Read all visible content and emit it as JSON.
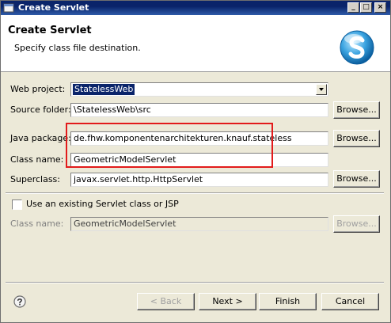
{
  "window": {
    "title": "Create Servlet",
    "controls": {
      "minimize": "_",
      "maximize": "□",
      "close": "×"
    }
  },
  "header": {
    "title": "Create Servlet",
    "subtitle": "Specify class file destination."
  },
  "form": {
    "web_project": {
      "label": "Web project:",
      "value": "StatelessWeb"
    },
    "source_folder": {
      "label": "Source folder:",
      "value": "\\StatelessWeb\\src",
      "browse": "Browse..."
    },
    "java_package": {
      "label": "Java package:",
      "value": "de.fhw.komponentenarchitekturen.knauf.stateless",
      "browse": "Browse..."
    },
    "class_name": {
      "label": "Class name:",
      "value": "GeometricModelServlet"
    },
    "superclass": {
      "label": "Superclass:",
      "value": "javax.servlet.http.HttpServlet",
      "browse": "Browse..."
    },
    "use_existing": {
      "label": "Use an existing Servlet class or JSP",
      "checked": false
    },
    "existing_class_name": {
      "label": "Class name:",
      "value": "GeometricModelServlet",
      "browse": "Browse..."
    }
  },
  "footer": {
    "back": "< Back",
    "next": "Next >",
    "finish": "Finish",
    "cancel": "Cancel"
  },
  "colors": {
    "title_bar": "#0a246a",
    "dialog_bg": "#ece9d8",
    "highlight_box": "#e21b1b",
    "selection": "#0a246a"
  }
}
